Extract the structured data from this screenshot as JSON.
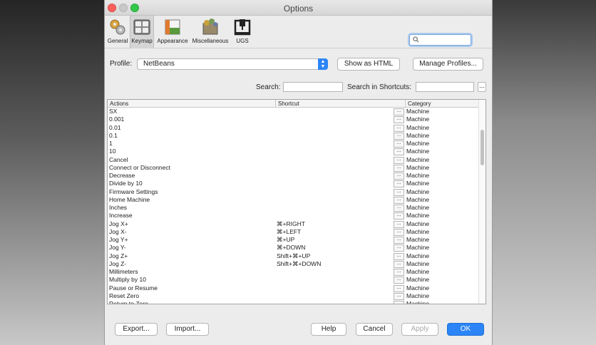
{
  "window": {
    "title": "Options"
  },
  "toolbar": {
    "items": [
      {
        "label": "General",
        "icon": "general-gears-icon"
      },
      {
        "label": "Keymap",
        "icon": "keymap-keyboard-icon"
      },
      {
        "label": "Appearance",
        "icon": "appearance-palette-icon"
      },
      {
        "label": "Miscellaneous",
        "icon": "miscellaneous-icon"
      },
      {
        "label": "UGS",
        "icon": "ugs-machine-icon"
      }
    ],
    "search_value": ""
  },
  "profile": {
    "label": "Profile:",
    "selected": "NetBeans",
    "show_html_label": "Show as HTML",
    "manage_label": "Manage Profiles..."
  },
  "search": {
    "label": "Search:",
    "value": "",
    "shortcuts_label": "Search in Shortcuts:",
    "shortcuts_value": "",
    "more_label": "..."
  },
  "table": {
    "headers": {
      "actions": "Actions",
      "shortcut": "Shortcut",
      "category": "Category"
    },
    "cell_button": "...",
    "rows": [
      {
        "action": "SX",
        "shortcut": "",
        "category": "Machine"
      },
      {
        "action": "0.001",
        "shortcut": "",
        "category": "Machine"
      },
      {
        "action": "0.01",
        "shortcut": "",
        "category": "Machine"
      },
      {
        "action": "0.1",
        "shortcut": "",
        "category": "Machine"
      },
      {
        "action": "1",
        "shortcut": "",
        "category": "Machine"
      },
      {
        "action": "10",
        "shortcut": "",
        "category": "Machine"
      },
      {
        "action": "Cancel",
        "shortcut": "",
        "category": "Machine"
      },
      {
        "action": "Connect or Disconnect",
        "shortcut": "",
        "category": "Machine"
      },
      {
        "action": "Decrease",
        "shortcut": "",
        "category": "Machine"
      },
      {
        "action": "Divide by 10",
        "shortcut": "",
        "category": "Machine"
      },
      {
        "action": "Firmware Settings",
        "shortcut": "",
        "category": "Machine"
      },
      {
        "action": "Home Machine",
        "shortcut": "",
        "category": "Machine"
      },
      {
        "action": "Inches",
        "shortcut": "",
        "category": "Machine"
      },
      {
        "action": "Increase",
        "shortcut": "",
        "category": "Machine"
      },
      {
        "action": "Jog X+",
        "shortcut": "⌘+RIGHT",
        "category": "Machine"
      },
      {
        "action": "Jog X-",
        "shortcut": "⌘+LEFT",
        "category": "Machine"
      },
      {
        "action": "Jog Y+",
        "shortcut": "⌘+UP",
        "category": "Machine"
      },
      {
        "action": "Jog Y-",
        "shortcut": "⌘+DOWN",
        "category": "Machine"
      },
      {
        "action": "Jog Z+",
        "shortcut": "Shift+⌘+UP",
        "category": "Machine"
      },
      {
        "action": "Jog Z-",
        "shortcut": "Shift+⌘+DOWN",
        "category": "Machine"
      },
      {
        "action": "Millimeters",
        "shortcut": "",
        "category": "Machine"
      },
      {
        "action": "Multiply by 10",
        "shortcut": "",
        "category": "Machine"
      },
      {
        "action": "Pause or Resume",
        "shortcut": "",
        "category": "Machine"
      },
      {
        "action": "Reset Zero",
        "shortcut": "",
        "category": "Machine"
      },
      {
        "action": "Return to Zero",
        "shortcut": "",
        "category": "Machine"
      }
    ]
  },
  "footer": {
    "export_label": "Export...",
    "import_label": "Import...",
    "help_label": "Help",
    "cancel_label": "Cancel",
    "apply_label": "Apply",
    "ok_label": "OK"
  },
  "colors": {
    "accent": "#2b85f6",
    "close": "#fc605c",
    "maximize": "#34c84a"
  }
}
